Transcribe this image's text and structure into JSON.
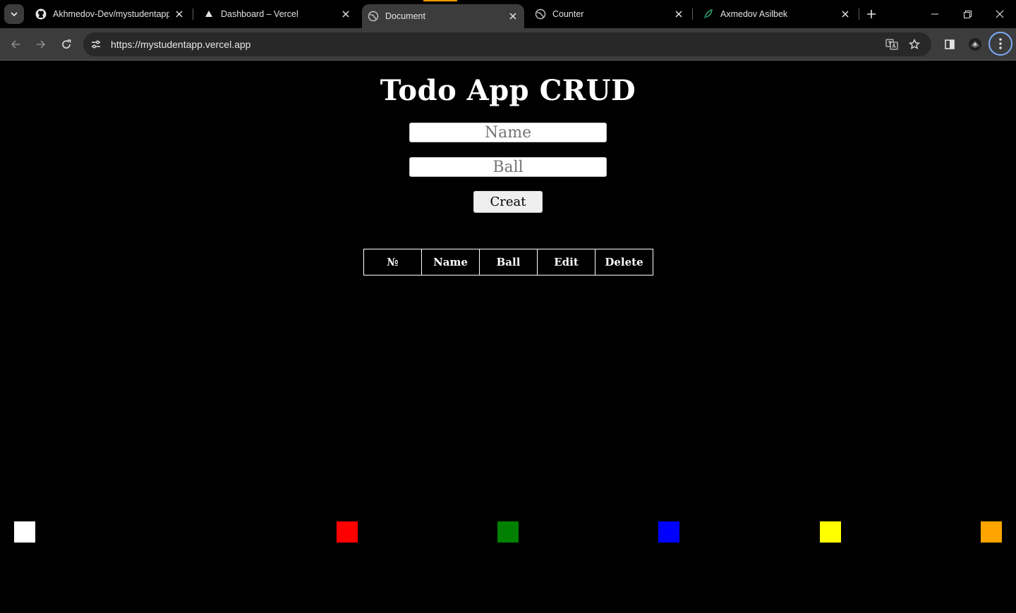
{
  "browser": {
    "tabs": [
      {
        "title": "Akhmedov-Dev/mystudentapp",
        "icon": "github-icon",
        "active": false
      },
      {
        "title": "Dashboard – Vercel",
        "icon": "vercel-icon",
        "active": false
      },
      {
        "title": "Document",
        "icon": "globe-icon",
        "active": true
      },
      {
        "title": "Counter",
        "icon": "globe-icon",
        "active": false
      },
      {
        "title": "Axmedov Asilbek",
        "icon": "leaf-icon",
        "active": false
      }
    ],
    "url": "https://mystudentapp.vercel.app"
  },
  "page": {
    "title": "Todo App CRUD",
    "name_placeholder": "Name",
    "ball_placeholder": "Ball",
    "create_label": "Creat",
    "table_headers": [
      "№",
      "Name",
      "Ball",
      "Edit",
      "Delete"
    ],
    "rows": []
  },
  "swatches": [
    {
      "name": "white",
      "color": "#ffffff"
    },
    {
      "name": "red",
      "color": "#ff0000"
    },
    {
      "name": "green",
      "color": "#008000"
    },
    {
      "name": "blue",
      "color": "#0000ff"
    },
    {
      "name": "yellow",
      "color": "#ffff00"
    },
    {
      "name": "orange",
      "color": "#ffa500"
    }
  ]
}
